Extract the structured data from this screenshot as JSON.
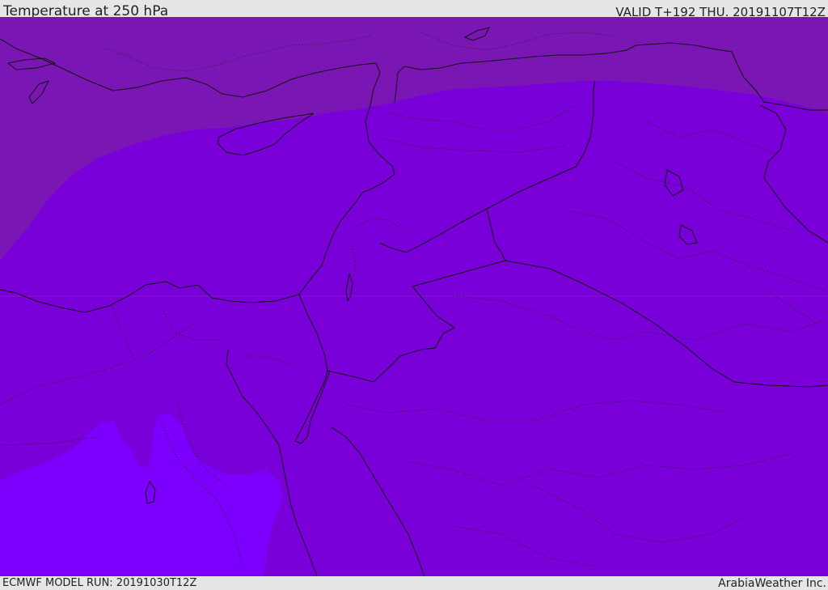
{
  "header": {
    "title": "Temperature at 250 hPa",
    "valid": "VALID T+192 THU. 20191107T12Z"
  },
  "footer": {
    "model_run": "ECMWF MODEL RUN: 20191030T12Z",
    "credit": "ArabiaWeather Inc."
  },
  "map": {
    "field": "temperature-250hPa",
    "colors": {
      "north_band": "#7a17b4",
      "main_band": "#7a00d9",
      "south_band": "#7d00ff",
      "coastline": "#111111",
      "border": "#111111"
    }
  }
}
